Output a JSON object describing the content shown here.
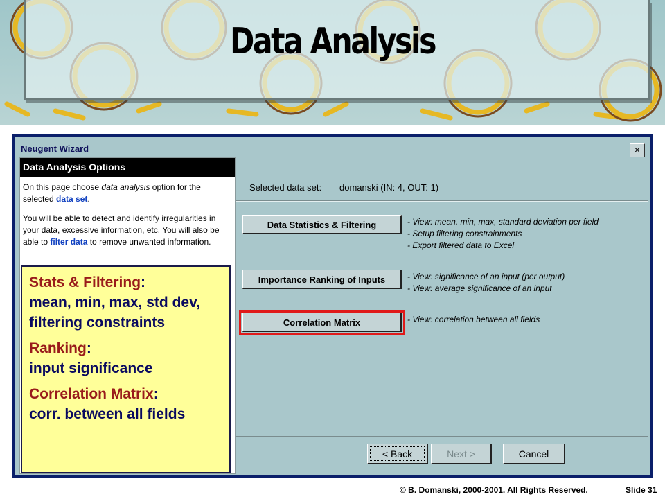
{
  "slide": {
    "title": "Data Analysis",
    "footer": "© B. Domanski, 2000-2001.  All Rights Reserved.",
    "slide_number": "Slide 31"
  },
  "window": {
    "title": "Neugent Wizard",
    "close_label": "×"
  },
  "help": {
    "heading": "Data Analysis Options",
    "p1_pre": "On this page choose ",
    "p1_em": "data analysis",
    "p1_mid": " option for the selected ",
    "p1_link": "data set",
    "p1_post": ".",
    "p2_pre": "You will be able to detect and identify irregularities in your data, excessive information, etc. You will also be able to ",
    "p2_link": "filter data",
    "p2_post": " to remove unwanted information."
  },
  "dataset": {
    "label": "Selected data set:",
    "value": "domanski (IN: 4, OUT: 1)"
  },
  "options": [
    {
      "button": "Data Statistics & Filtering",
      "lines": [
        "- View: mean, min, max, standard deviation per field",
        "- Setup filtering constrainments",
        "- Export filtered data to Excel"
      ]
    },
    {
      "button": "Importance Ranking of Inputs",
      "lines": [
        "- View: significance of an input (per output)",
        "- View: average significance of an input"
      ]
    },
    {
      "button": "Correlation Matrix",
      "lines": [
        "- View: correlation between all fields"
      ]
    }
  ],
  "nav": {
    "back": "< Back",
    "next": "Next >",
    "cancel": "Cancel"
  },
  "callout": [
    {
      "head": "Stats & Filtering",
      "body": " mean, min, max, std dev, filtering constraints"
    },
    {
      "head": "Ranking",
      "body": " input significance"
    },
    {
      "head": "Correlation Matrix",
      "body": " corr. between all fields"
    }
  ]
}
